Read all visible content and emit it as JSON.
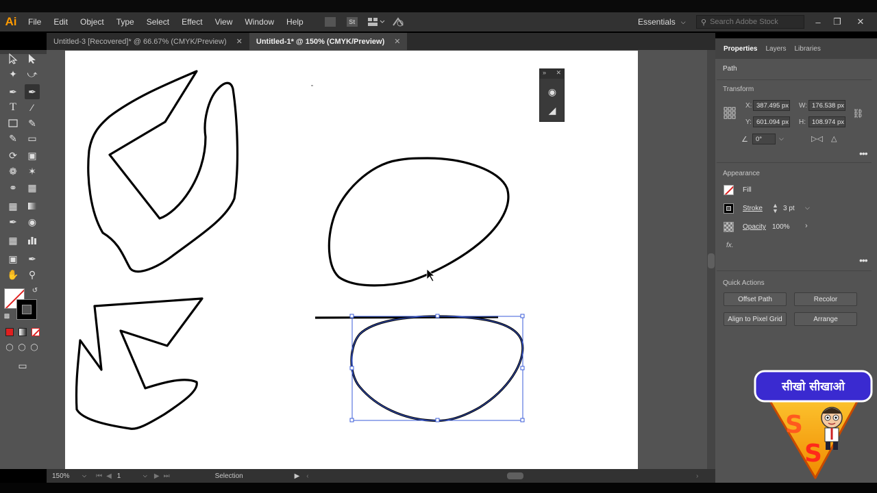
{
  "app": {
    "logo": "Ai"
  },
  "menu": {
    "items": [
      "File",
      "Edit",
      "Object",
      "Type",
      "Select",
      "Effect",
      "View",
      "Window",
      "Help"
    ]
  },
  "menubar_icons": {
    "stock_label": "St"
  },
  "workspace": {
    "label": "Essentials"
  },
  "search": {
    "placeholder": "Search Adobe Stock"
  },
  "tabs": [
    {
      "label": "Untitled-3 [Recovered]* @ 66.67% (CMYK/Preview)",
      "active": false
    },
    {
      "label": "Untitled-1* @ 150% (CMYK/Preview)",
      "active": true
    }
  ],
  "status": {
    "zoom": "150%",
    "artboard": "1",
    "tool": "Selection"
  },
  "panel": {
    "tabs": [
      "Properties",
      "Layers",
      "Libraries"
    ],
    "object_type": "Path",
    "transform": {
      "title": "Transform",
      "x_label": "X:",
      "x": "387.495 px",
      "y_label": "Y:",
      "y": "601.094 px",
      "w_label": "W:",
      "w": "176.538 px",
      "h_label": "H:",
      "h": "108.974 px",
      "angle": "0°"
    },
    "appearance": {
      "title": "Appearance",
      "fill_label": "Fill",
      "stroke_label": "Stroke",
      "stroke_weight": "3 pt",
      "opacity_label": "Opacity",
      "opacity": "100%",
      "fx": "fx."
    },
    "quick_actions": {
      "title": "Quick Actions",
      "buttons": [
        "Offset Path",
        "Recolor",
        "Align to Pixel Grid",
        "Arrange"
      ]
    }
  },
  "watermark": {
    "text": "सीखो सीखाओ",
    "letters": [
      "S",
      "S"
    ]
  },
  "colors": {
    "accent": "#ff9a00",
    "selection": "#3a5bd9",
    "stroke_swatch": "#000000",
    "fill_none": "#e02020"
  }
}
